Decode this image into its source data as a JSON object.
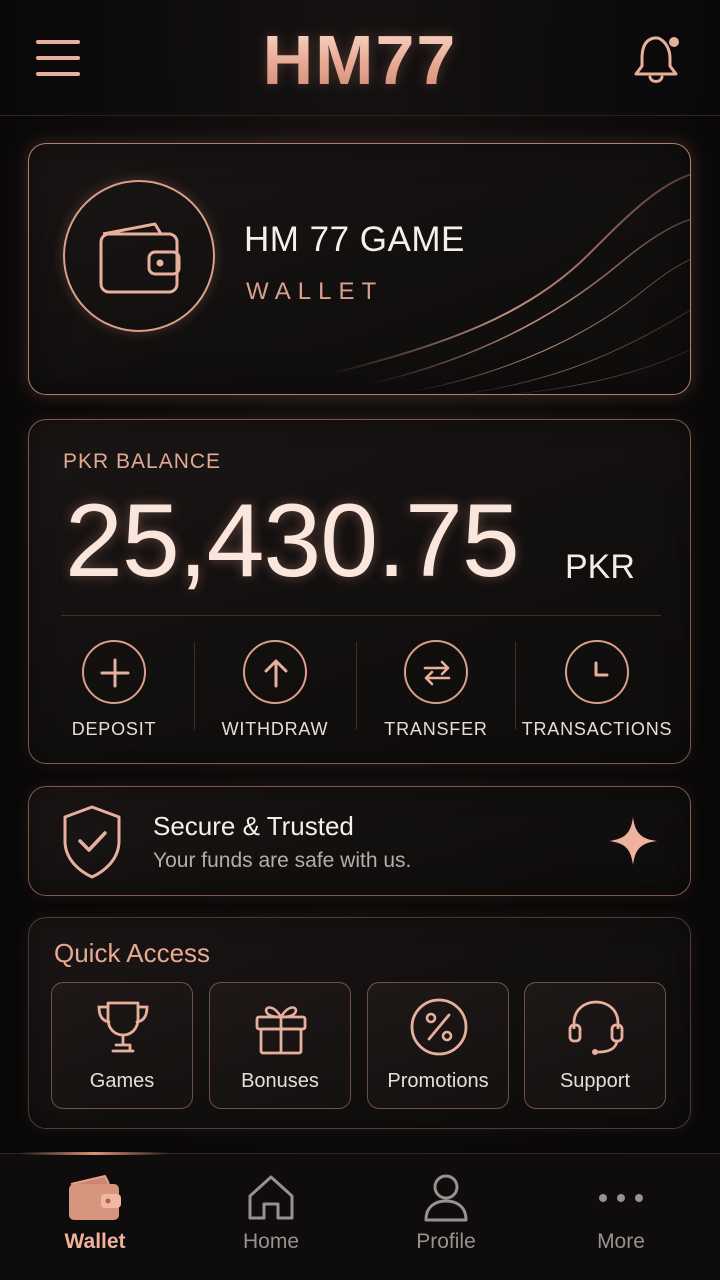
{
  "header": {
    "brand": "HM77",
    "menu_icon": "hamburger-menu-icon",
    "notification_icon": "bell-icon"
  },
  "wallet_card": {
    "title": "HM 77 GAME",
    "subtitle": "WALLET",
    "icon": "wallet-icon"
  },
  "balance": {
    "label": "PKR BALANCE",
    "amount": "25,430.75",
    "currency": "PKR",
    "actions": [
      {
        "label": "DEPOSIT",
        "icon": "plus-icon"
      },
      {
        "label": "WITHDRAW",
        "icon": "arrow-up-icon"
      },
      {
        "label": "TRANSFER",
        "icon": "transfer-icon"
      },
      {
        "label": "TRANSACTIONS",
        "icon": "clock-icon"
      }
    ]
  },
  "secure": {
    "title": "Secure & Trusted",
    "subtitle": "Your funds are safe with us.",
    "icon": "shield-check-icon"
  },
  "quick_access": {
    "title": "Quick Access",
    "items": [
      {
        "label": "Games",
        "icon": "trophy-icon"
      },
      {
        "label": "Bonuses",
        "icon": "gift-icon"
      },
      {
        "label": "Promotions",
        "icon": "percent-icon"
      },
      {
        "label": "Support",
        "icon": "headset-icon"
      }
    ]
  },
  "bottom_nav": {
    "items": [
      {
        "label": "Wallet",
        "icon": "wallet-icon",
        "active": true
      },
      {
        "label": "Home",
        "icon": "home-icon"
      },
      {
        "label": "Profile",
        "icon": "user-icon"
      },
      {
        "label": "More",
        "icon": "more-dots-icon"
      }
    ]
  },
  "colors": {
    "accent": "#e8a993",
    "background": "#0c0a0a",
    "card_border": "#d69680"
  }
}
